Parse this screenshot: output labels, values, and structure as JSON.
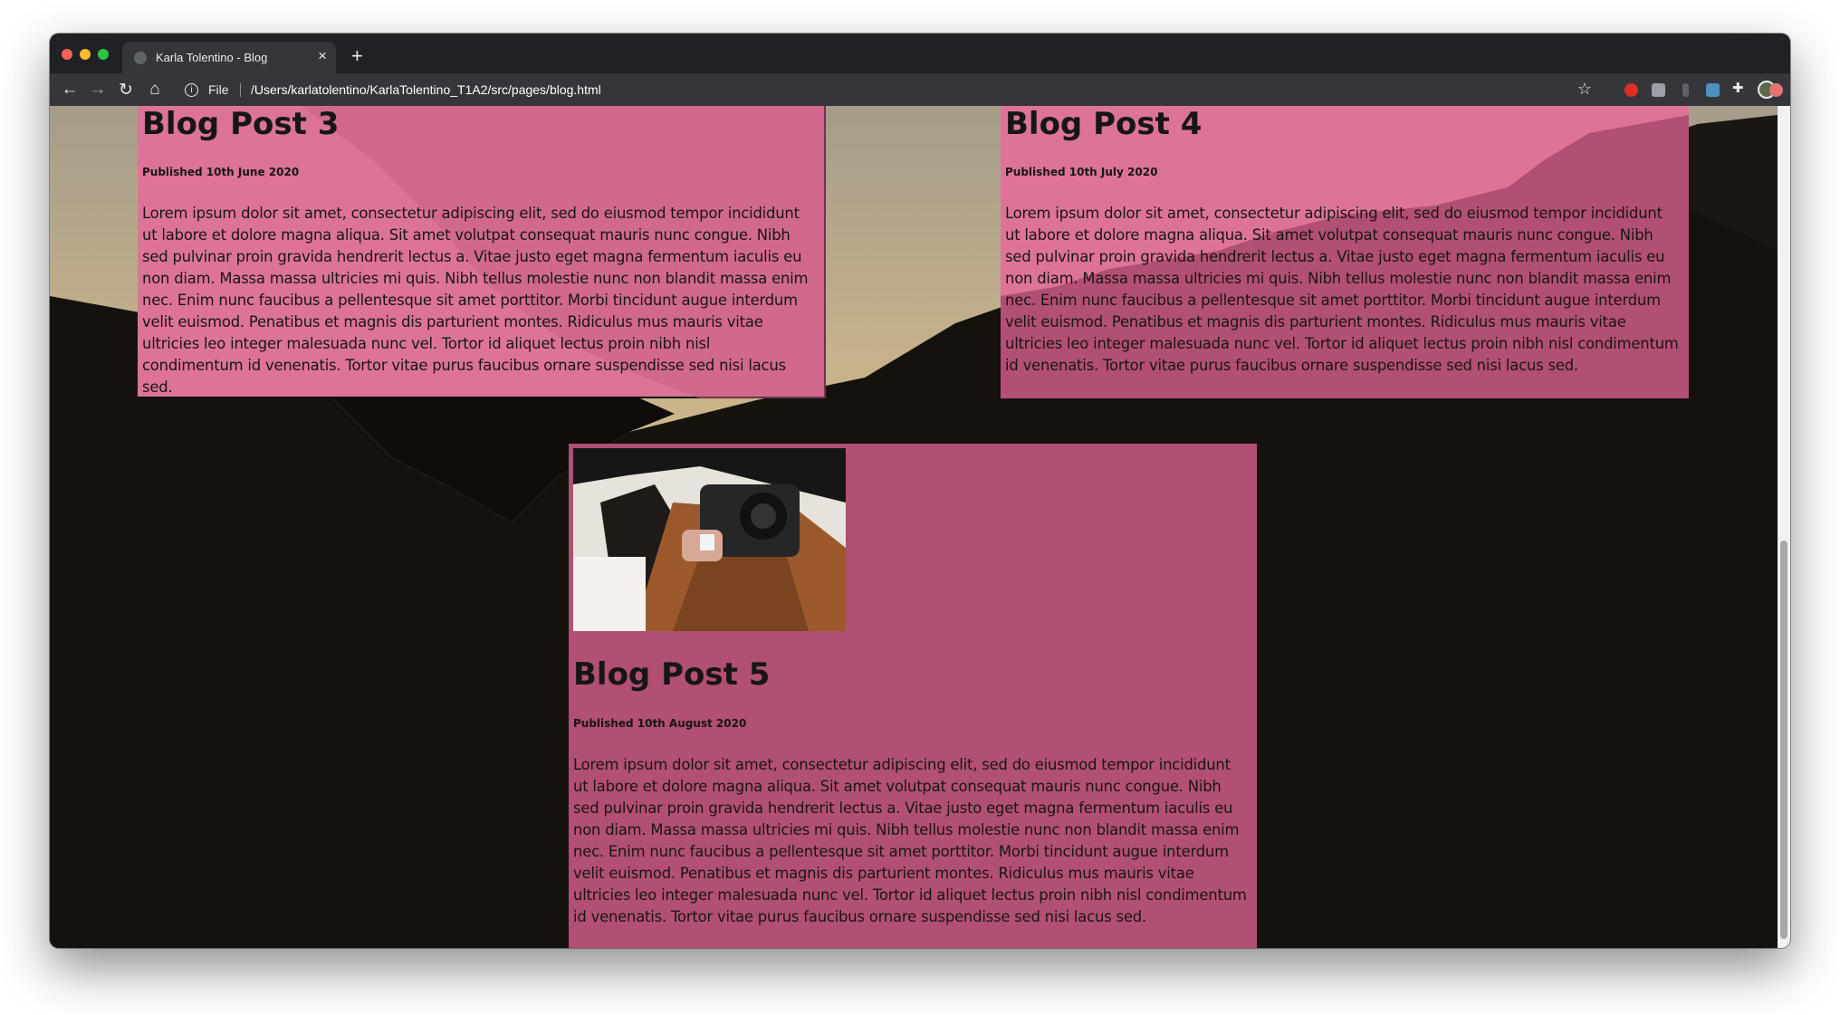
{
  "browser": {
    "tab_title": "Karla Tolentino - Blog",
    "tab_close": "×",
    "new_tab": "+",
    "scheme_label": "File",
    "url": "/Users/karlatolentino/KarlaTolentino_T1A2/src/pages/blog.html",
    "icons": [
      "back-arrow-icon",
      "forward-arrow-icon",
      "reload-icon",
      "home-icon",
      "info-icon",
      "star-icon",
      "extensions-puzzle-icon",
      "profile-avatar-icon"
    ]
  },
  "colors": {
    "card_pink": "#b24f74",
    "card_light_pink": "#dd7497",
    "page_background": "#15120e"
  },
  "posts": [
    {
      "title": "Blog Post 3",
      "date": "Published 10th June 2020",
      "body": "Lorem ipsum dolor sit amet, consectetur adipiscing elit, sed do eiusmod tempor incididunt ut labore et dolore magna aliqua. Sit amet volutpat consequat mauris nunc congue. Nibh sed pulvinar proin gravida hendrerit lectus a. Vitae justo eget magna fermentum iaculis eu non diam. Massa massa ultricies mi quis. Nibh tellus molestie nunc non blandit massa enim nec. Enim nunc faucibus a pellentesque sit amet porttitor. Morbi tincidunt augue interdum velit euismod. Penatibus et magnis dis parturient montes. Ridiculus mus mauris vitae ultricies leo integer malesuada nunc vel. Tortor id aliquet lectus proin nibh nisl condimentum id venenatis. Tortor vitae purus faucibus ornare suspendisse sed nisi lacus sed."
    },
    {
      "title": "Blog Post 4",
      "date": "Published 10th July 2020",
      "body": "Lorem ipsum dolor sit amet, consectetur adipiscing elit, sed do eiusmod tempor incididunt ut labore et dolore magna aliqua. Sit amet volutpat consequat mauris nunc congue. Nibh sed pulvinar proin gravida hendrerit lectus a. Vitae justo eget magna fermentum iaculis eu non diam. Massa massa ultricies mi quis. Nibh tellus molestie nunc non blandit massa enim nec. Enim nunc faucibus a pellentesque sit amet porttitor. Morbi tincidunt augue interdum velit euismod. Penatibus et magnis dis parturient montes. Ridiculus mus mauris vitae ultricies leo integer malesuada nunc vel. Tortor id aliquet lectus proin nibh nisl condimentum id venenatis. Tortor vitae purus faucibus ornare suspendisse sed nisi lacus sed."
    },
    {
      "title": "Blog Post 5",
      "date": "Published 10th August 2020",
      "body": "Lorem ipsum dolor sit amet, consectetur adipiscing elit, sed do eiusmod tempor incididunt ut labore et dolore magna aliqua. Sit amet volutpat consequat mauris nunc congue. Nibh sed pulvinar proin gravida hendrerit lectus a. Vitae justo eget magna fermentum iaculis eu non diam. Massa massa ultricies mi quis. Nibh tellus molestie nunc non blandit massa enim nec. Enim nunc faucibus a pellentesque sit amet porttitor. Morbi tincidunt augue interdum velit euismod. Penatibus et magnis dis parturient montes. Ridiculus mus mauris vitae ultricies leo integer malesuada nunc vel. Tortor id aliquet lectus proin nibh nisl condimentum id venenatis. Tortor vitae purus faucibus ornare suspendisse sed nisi lacus sed."
    }
  ]
}
